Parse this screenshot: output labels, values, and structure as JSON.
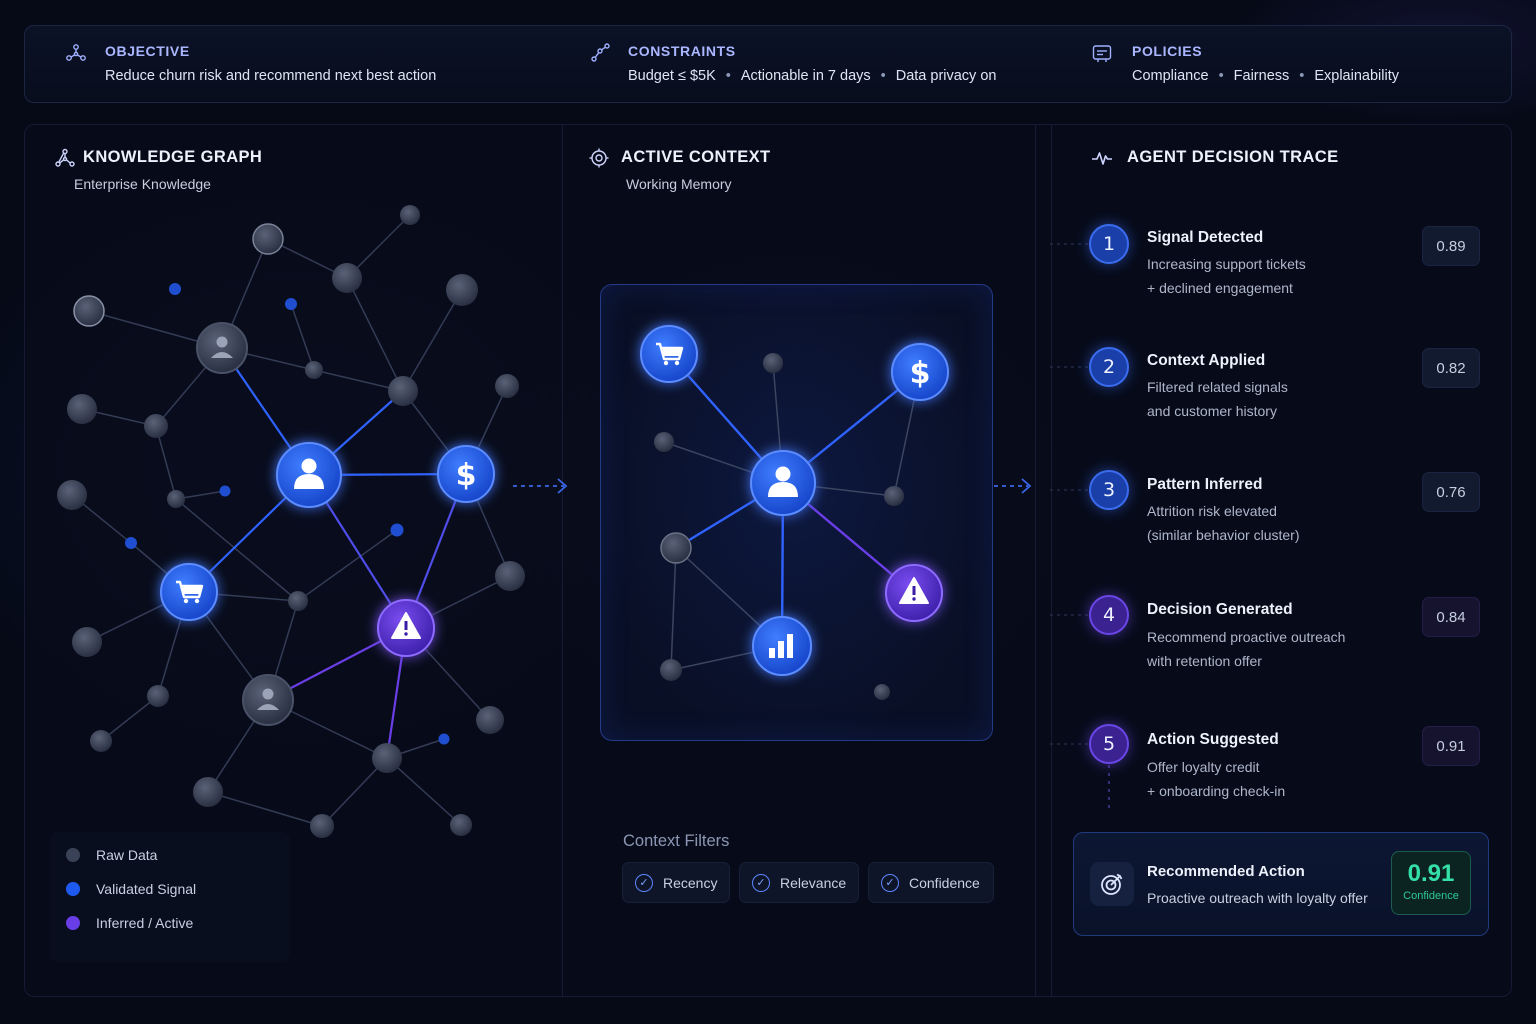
{
  "topbar": {
    "objective": {
      "title": "OBJECTIVE",
      "text": "Reduce churn risk and recommend next best action",
      "icon": "graph-network-icon"
    },
    "constraints": {
      "title": "CONSTRAINTS",
      "items": [
        "Budget ≤ $5K",
        "Actionable in 7 days",
        "Data privacy on"
      ],
      "icon": "scatter-connect-icon"
    },
    "policies": {
      "title": "POLICIES",
      "items": [
        "Compliance",
        "Fairness",
        "Explainability"
      ],
      "icon": "policy-card-icon"
    }
  },
  "knowledge_graph": {
    "title": "KNOWLEDGE GRAPH",
    "subtitle": "Enterprise Knowledge",
    "legend": [
      {
        "label": "Raw Data",
        "color": "#3a4258"
      },
      {
        "label": "Validated Signal",
        "color": "#1f5af0"
      },
      {
        "label": "Inferred / Active",
        "color": "#6a3ee6"
      }
    ],
    "node_icons": [
      "user-icon",
      "dollar-icon",
      "cart-icon",
      "warning-icon"
    ]
  },
  "active_context": {
    "title": "ACTIVE CONTEXT",
    "subtitle": "Working Memory",
    "filters_title": "Context Filters",
    "filters": [
      "Recency",
      "Relevance",
      "Confidence"
    ],
    "node_icons": [
      "cart-icon",
      "dollar-icon",
      "user-icon",
      "warning-icon",
      "bar-chart-icon"
    ]
  },
  "decision_trace": {
    "title": "AGENT DECISION TRACE",
    "steps": [
      {
        "number": "1",
        "title": "Signal Detected",
        "desc": [
          "Increasing support tickets",
          "+ declined engagement"
        ],
        "score": "0.89",
        "tone": "blue"
      },
      {
        "number": "2",
        "title": "Context Applied",
        "desc": [
          "Filtered related signals",
          "and customer history"
        ],
        "score": "0.82",
        "tone": "blue"
      },
      {
        "number": "3",
        "title": "Pattern Inferred",
        "desc": [
          "Attrition risk elevated",
          "(similar behavior cluster)"
        ],
        "score": "0.76",
        "tone": "blue"
      },
      {
        "number": "4",
        "title": "Decision Generated",
        "desc": [
          "Recommend proactive outreach",
          "with retention offer"
        ],
        "score": "0.84",
        "tone": "purple"
      },
      {
        "number": "5",
        "title": "Action Suggested",
        "desc": [
          "Offer loyalty credit",
          "+ onboarding check-in"
        ],
        "score": "0.91",
        "tone": "purple"
      }
    ],
    "recommendation": {
      "title": "Recommended Action",
      "text": "Proactive outreach with loyalty offer",
      "confidence_value": "0.91",
      "confidence_label": "Confidence"
    }
  },
  "colors": {
    "background": "#060a17",
    "blue_accent": "#1f5af0",
    "purple_accent": "#6a3ee6",
    "confidence_green": "#35e0a8"
  }
}
